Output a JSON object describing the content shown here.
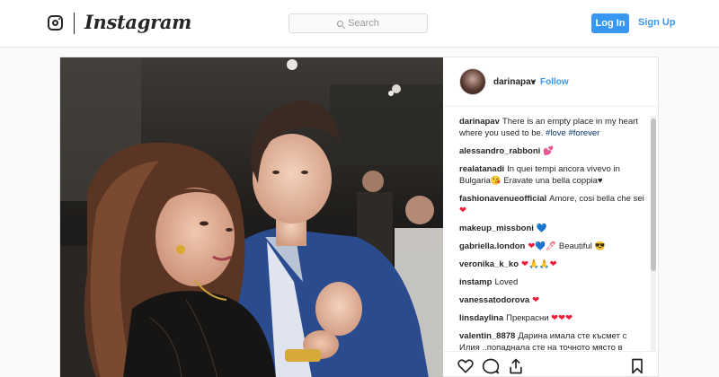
{
  "header": {
    "brand": "Instagram",
    "search_placeholder": "Search",
    "login_label": "Log In",
    "signup_label": "Sign Up",
    "accent": "#3897f0"
  },
  "post": {
    "username": "darinapav",
    "separator": "•",
    "follow_label": "Follow",
    "caption_text": "There is an empty place in my heart where you used to be.",
    "hashtags": [
      "#love",
      "#forever"
    ],
    "comments": [
      {
        "user": "alessandro_rabboni",
        "text": "",
        "emoji": "💕"
      },
      {
        "user": "realatanadi",
        "text": "In quei tempi ancora vivevo in Bulgaria😘 Eravate una bella coppia♥",
        "emoji": ""
      },
      {
        "user": "fashionavenueofficial",
        "text": "Amore, cosi bella che sei",
        "emoji": "❤"
      },
      {
        "user": "makeup_missboni",
        "text": "",
        "emoji": "💙"
      },
      {
        "user": "gabriella.london",
        "text": "Beautiful",
        "emoji": "❤💙🖊",
        "emoji_after": "😎"
      },
      {
        "user": "veronika_k_ko",
        "text": "",
        "emoji": "❤🙏🙏❤"
      },
      {
        "user": "instamp",
        "text": "Loved",
        "emoji": ""
      },
      {
        "user": "vanessatodorova",
        "text": "",
        "emoji": "❤"
      },
      {
        "user": "linsdaylina",
        "text": "Прекрасни",
        "emoji": "❤❤❤"
      },
      {
        "user": "valentin_8878",
        "text": "Дарина имала сте късмет с Илия ..попаднала сте на точното място в точното време с точния човек ...да не изпадаме в подробности ...жива и здрава",
        "emoji": ""
      }
    ]
  },
  "icons": [
    "instagram-logo-icon",
    "search-icon",
    "heart-icon",
    "comment-icon",
    "share-icon",
    "bookmark-icon"
  ]
}
